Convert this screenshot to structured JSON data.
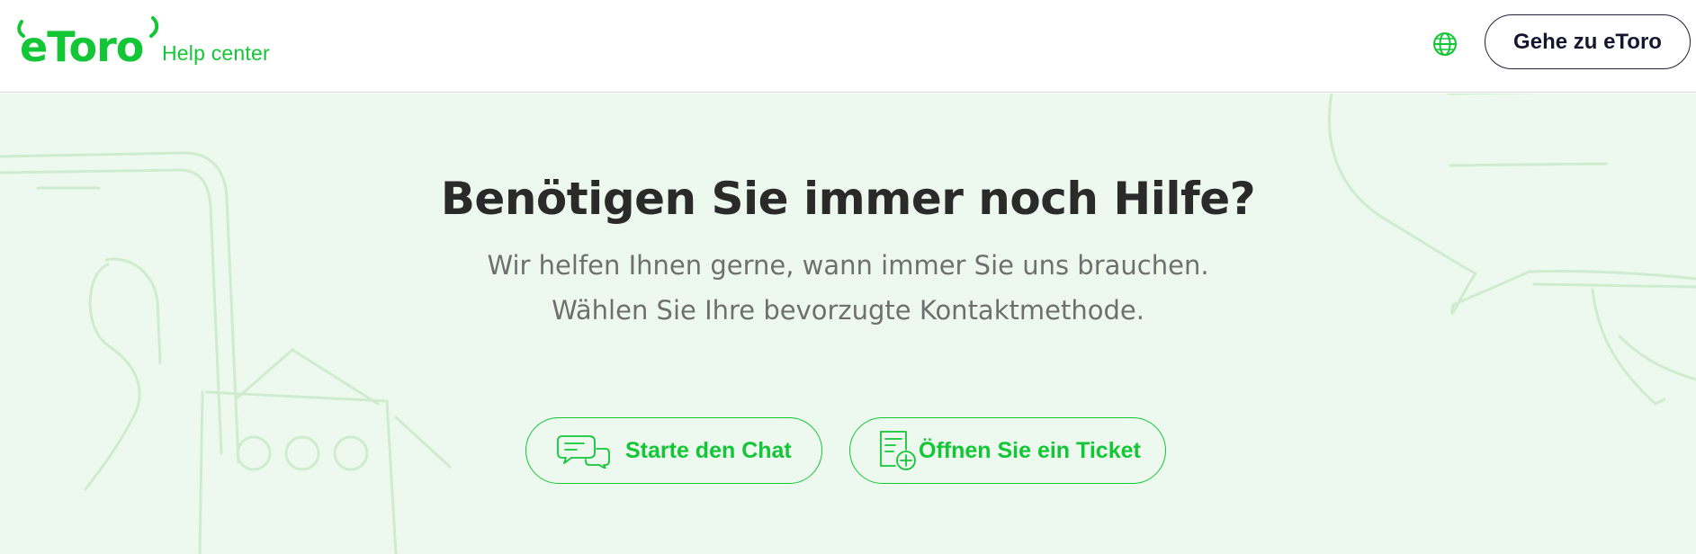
{
  "header": {
    "logo_text": "eToro",
    "subtitle": "Help center",
    "language_icon": "globe-icon",
    "goto_button_label": "Gehe zu eToro"
  },
  "hero": {
    "title": "Benötigen Sie immer noch Hilfe?",
    "subtitle_line1": "Wir helfen Ihnen gerne, wann immer Sie uns brauchen.",
    "subtitle_line2": "Wählen Sie Ihre bevorzugte Kontaktmethode.",
    "buttons": [
      {
        "label": "Starte den Chat",
        "icon": "chat-bubbles-icon"
      },
      {
        "label": "Öffnen Sie ein Ticket",
        "icon": "ticket-add-icon"
      }
    ]
  },
  "colors": {
    "brand_green": "#13c636",
    "hero_background": "#edf9ee",
    "title_text": "#2a2a2a",
    "subtitle_text": "#6f6f6f"
  }
}
